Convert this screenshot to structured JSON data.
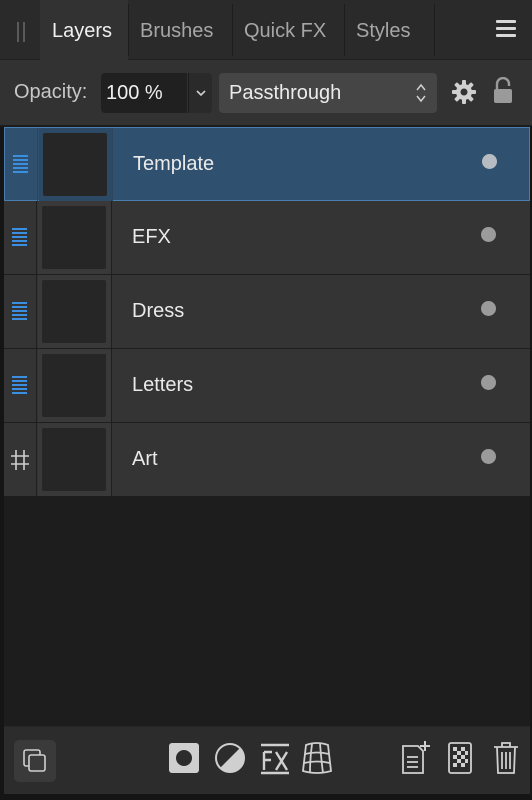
{
  "tabs": [
    {
      "label": "Layers",
      "active": true
    },
    {
      "label": "Brushes",
      "active": false
    },
    {
      "label": "Quick FX",
      "active": false
    },
    {
      "label": "Styles",
      "active": false
    }
  ],
  "options": {
    "opacity_label": "Opacity:",
    "opacity_value": "100 %",
    "blend_mode": "Passthrough"
  },
  "layers": [
    {
      "name": "Template",
      "selected": true,
      "type": "group"
    },
    {
      "name": "EFX",
      "selected": false,
      "type": "group"
    },
    {
      "name": "Dress",
      "selected": false,
      "type": "group"
    },
    {
      "name": "Letters",
      "selected": false,
      "type": "group"
    },
    {
      "name": "Art",
      "selected": false,
      "type": "grid"
    }
  ],
  "colors": {
    "accent": "#3a8fe0",
    "selection": "#30506f",
    "panel": "#323232"
  },
  "icons": {
    "menu": "hamburger-icon",
    "settings": "gear-icon",
    "lock": "lock-icon",
    "group": "group-lines-icon",
    "grid": "grid-icon",
    "bottom": [
      "layer-copy-icon",
      "mask-icon",
      "adjustment-icon",
      "fx-icon",
      "warp-icon",
      "add-layer-icon",
      "pixel-layer-icon",
      "trash-icon"
    ]
  }
}
